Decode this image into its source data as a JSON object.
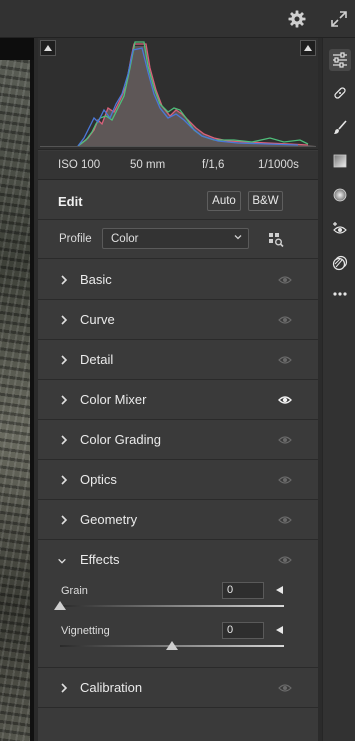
{
  "exif": {
    "iso": "ISO 100",
    "focal_length": "50 mm",
    "aperture": "f/1,6",
    "shutter": "1/1000s"
  },
  "edit": {
    "title": "Edit",
    "auto_label": "Auto",
    "bw_label": "B&W"
  },
  "profile": {
    "label": "Profile",
    "value": "Color"
  },
  "sections": [
    {
      "label": "Basic",
      "expanded": false,
      "visible_eye": false
    },
    {
      "label": "Curve",
      "expanded": false,
      "visible_eye": false
    },
    {
      "label": "Detail",
      "expanded": false,
      "visible_eye": false
    },
    {
      "label": "Color Mixer",
      "expanded": false,
      "visible_eye": true
    },
    {
      "label": "Color Grading",
      "expanded": false,
      "visible_eye": false
    },
    {
      "label": "Optics",
      "expanded": false,
      "visible_eye": false
    },
    {
      "label": "Geometry",
      "expanded": false,
      "visible_eye": false
    },
    {
      "label": "Effects",
      "expanded": true,
      "visible_eye": false
    },
    {
      "label": "Calibration",
      "expanded": false,
      "visible_eye": false
    }
  ],
  "effects": {
    "grain": {
      "label": "Grain",
      "value": "0",
      "level": 0.0
    },
    "vignetting": {
      "label": "Vignetting",
      "value": "0",
      "level": 0.5
    }
  },
  "toolbar": {
    "icons": [
      "edit-sliders-icon",
      "healing-icon",
      "masking-brush-icon",
      "gradient-icon",
      "radial-icon",
      "red-eye-icon",
      "presets-icon",
      "more-icon"
    ],
    "active": "edit-sliders-icon"
  },
  "colors": {
    "panel_bg": "#3a3a3a",
    "header_bg": "#323232",
    "histogram_red": "#d9607a",
    "histogram_green": "#4fbf7a",
    "histogram_blue": "#4a78d8"
  }
}
